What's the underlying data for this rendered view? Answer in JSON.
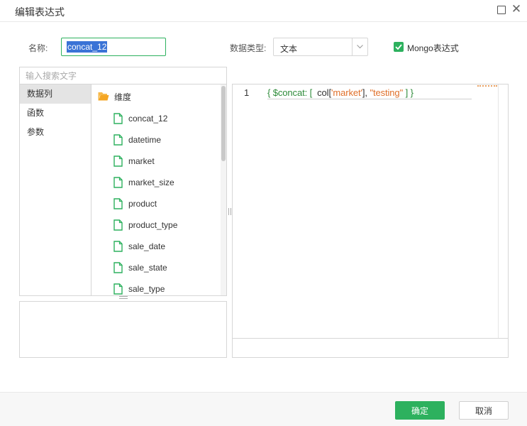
{
  "dialog": {
    "title": "编辑表达式",
    "maximize_icon": "maximize-square-icon",
    "close_icon": "close-x-icon"
  },
  "form": {
    "name_label": "名称:",
    "name_value": "concat_12",
    "type_label": "数据类型:",
    "type_value": "文本",
    "mongo_label": "Mongo表达式",
    "mongo_checked": true
  },
  "search": {
    "placeholder": "输入搜索文字"
  },
  "categories": [
    {
      "label": "数据列",
      "active": true
    },
    {
      "label": "函数",
      "active": false
    },
    {
      "label": "参数",
      "active": false
    }
  ],
  "tree": {
    "folder": {
      "label": "维度",
      "icon": "folder-icon"
    },
    "fields": [
      {
        "label": "concat_12",
        "icon": "file-icon"
      },
      {
        "label": "datetime",
        "icon": "file-icon"
      },
      {
        "label": "market",
        "icon": "file-icon"
      },
      {
        "label": "market_size",
        "icon": "file-icon"
      },
      {
        "label": "product",
        "icon": "file-icon"
      },
      {
        "label": "product_type",
        "icon": "file-icon"
      },
      {
        "label": "sale_date",
        "icon": "file-icon"
      },
      {
        "label": "sale_state",
        "icon": "file-icon"
      },
      {
        "label": "sale_type",
        "icon": "file-icon"
      }
    ]
  },
  "editor": {
    "line_number": "1",
    "code": {
      "open": "{ $concat: [  ",
      "col": "col[",
      "str1": "'market'",
      "close_bracket": "],",
      "str2": " \"testing\"",
      "end": " ] }"
    }
  },
  "buttons": {
    "ok": "确定",
    "cancel": "取消"
  },
  "colors": {
    "accent": "#2db15e",
    "selection": "#3a73d6",
    "string": "#e0702a"
  }
}
